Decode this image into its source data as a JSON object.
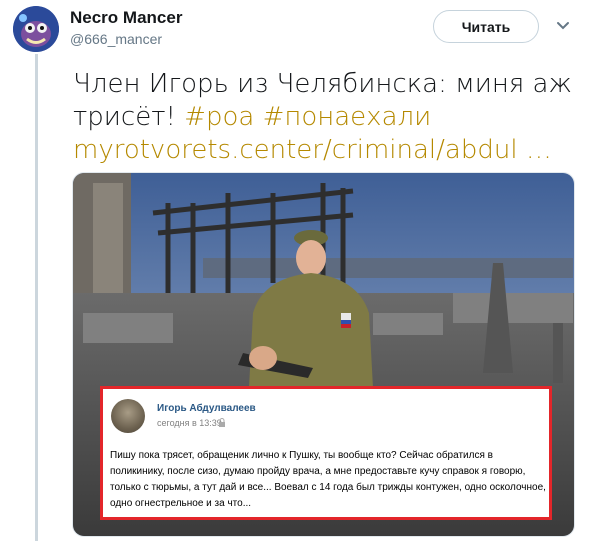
{
  "user": {
    "name": "Necro Mancer",
    "handle": "@666_mancer",
    "follow_label": "Читать"
  },
  "tweet": {
    "line1": "Член Игорь из Челябинска: миня аж",
    "line2_text": "трисёт! ",
    "hashtags": [
      "#роа",
      "#понаехали"
    ],
    "link": "myrotvorets.center/criminal/abdul …"
  },
  "vk_post": {
    "author": "Игорь Абдулвалеев",
    "time": "сегодня в 13:39",
    "text": "Пишу пока трясет, обращеник лично к Пушку, ты вообще кто? Сейчас обратился в поликинику, после сизо, думаю пройду врача, а мне предоставьте кучу справок я говорю, только с тюрьмы, а тут дай и все... Воевал с 14 года был трижды контужен, одно осколочное, одно огнестрельное и за что..."
  },
  "colors": {
    "link": "#b58900",
    "vk_border": "#e3262a",
    "vk_name": "#2a5885"
  },
  "icons": [
    "avatar-image",
    "chevron-down-icon",
    "lock-icon"
  ]
}
